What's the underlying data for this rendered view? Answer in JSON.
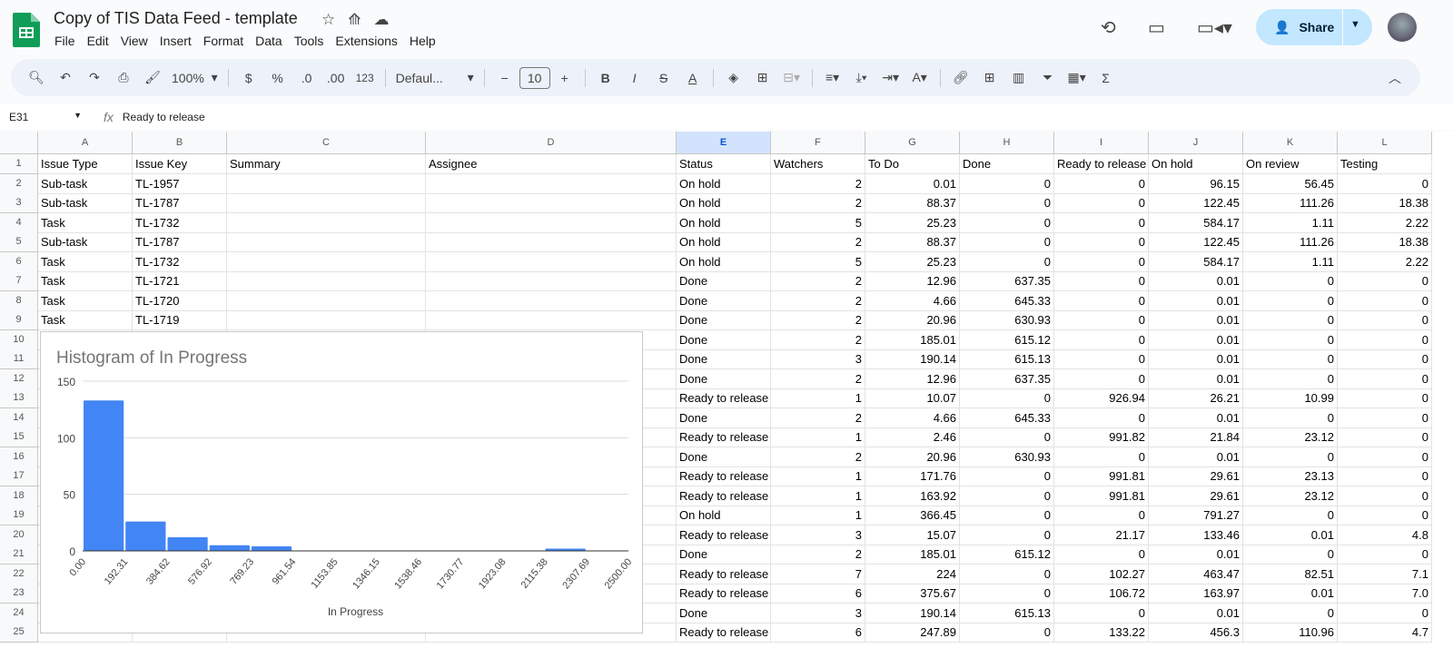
{
  "app": {
    "title": "Copy of TIS Data Feed - template",
    "menu": [
      "File",
      "Edit",
      "View",
      "Insert",
      "Format",
      "Data",
      "Tools",
      "Extensions",
      "Help"
    ],
    "share_label": "Share"
  },
  "toolbar": {
    "zoom": "100%",
    "currency": "$",
    "percent": "%",
    "dec_dec": ".0",
    "inc_dec": ".00",
    "format_123": "123",
    "font": "Defaul...",
    "font_size": "10"
  },
  "formula_bar": {
    "cell_ref": "E31",
    "fx": "fx",
    "value": "Ready to release"
  },
  "columns": [
    "A",
    "B",
    "C",
    "D",
    "E",
    "F",
    "G",
    "H",
    "I",
    "J",
    "K",
    "L"
  ],
  "headers": [
    "Issue Type",
    "Issue Key",
    "Summary",
    "Assignee",
    "Status",
    "Watchers",
    "To Do",
    "Done",
    "Ready to release",
    "On hold",
    "On review",
    "Testing"
  ],
  "rows": [
    [
      "Sub-task",
      "TL-1957",
      "",
      "",
      "On hold",
      "2",
      "0.01",
      "0",
      "0",
      "96.15",
      "56.45",
      "0"
    ],
    [
      "Sub-task",
      "TL-1787",
      "",
      "",
      "On hold",
      "2",
      "88.37",
      "0",
      "0",
      "122.45",
      "111.26",
      "18.38"
    ],
    [
      "Task",
      "TL-1732",
      "",
      "",
      "On hold",
      "5",
      "25.23",
      "0",
      "0",
      "584.17",
      "1.11",
      "2.22"
    ],
    [
      "Sub-task",
      "TL-1787",
      "",
      "",
      "On hold",
      "2",
      "88.37",
      "0",
      "0",
      "122.45",
      "111.26",
      "18.38"
    ],
    [
      "Task",
      "TL-1732",
      "",
      "",
      "On hold",
      "5",
      "25.23",
      "0",
      "0",
      "584.17",
      "1.11",
      "2.22"
    ],
    [
      "Task",
      "TL-1721",
      "",
      "",
      "Done",
      "2",
      "12.96",
      "637.35",
      "0",
      "0.01",
      "0",
      "0"
    ],
    [
      "Task",
      "TL-1720",
      "",
      "",
      "Done",
      "2",
      "4.66",
      "645.33",
      "0",
      "0.01",
      "0",
      "0"
    ],
    [
      "Task",
      "TL-1719",
      "",
      "",
      "Done",
      "2",
      "20.96",
      "630.93",
      "0",
      "0.01",
      "0",
      "0"
    ],
    [
      "",
      "",
      "",
      "",
      "Done",
      "2",
      "185.01",
      "615.12",
      "0",
      "0.01",
      "0",
      "0"
    ],
    [
      "",
      "",
      "",
      "",
      "Done",
      "3",
      "190.14",
      "615.13",
      "0",
      "0.01",
      "0",
      "0"
    ],
    [
      "",
      "",
      "",
      "",
      "Done",
      "2",
      "12.96",
      "637.35",
      "0",
      "0.01",
      "0",
      "0"
    ],
    [
      "",
      "",
      "",
      "",
      "Ready to release",
      "1",
      "10.07",
      "0",
      "926.94",
      "26.21",
      "10.99",
      "0"
    ],
    [
      "",
      "",
      "",
      "",
      "Done",
      "2",
      "4.66",
      "645.33",
      "0",
      "0.01",
      "0",
      "0"
    ],
    [
      "",
      "",
      "",
      "",
      "Ready to release",
      "1",
      "2.46",
      "0",
      "991.82",
      "21.84",
      "23.12",
      "0"
    ],
    [
      "",
      "",
      "",
      "",
      "Done",
      "2",
      "20.96",
      "630.93",
      "0",
      "0.01",
      "0",
      "0"
    ],
    [
      "",
      "",
      "",
      "",
      "Ready to release",
      "1",
      "171.76",
      "0",
      "991.81",
      "29.61",
      "23.13",
      "0"
    ],
    [
      "",
      "",
      "",
      "",
      "Ready to release",
      "1",
      "163.92",
      "0",
      "991.81",
      "29.61",
      "23.12",
      "0"
    ],
    [
      "",
      "",
      "",
      "",
      "On hold",
      "1",
      "366.45",
      "0",
      "0",
      "791.27",
      "0",
      "0"
    ],
    [
      "",
      "",
      "",
      "",
      "Ready to release",
      "3",
      "15.07",
      "0",
      "21.17",
      "133.46",
      "0.01",
      "4.8"
    ],
    [
      "",
      "",
      "",
      "",
      "Done",
      "2",
      "185.01",
      "615.12",
      "0",
      "0.01",
      "0",
      "0"
    ],
    [
      "",
      "",
      "",
      "",
      "Ready to release",
      "7",
      "224",
      "0",
      "102.27",
      "463.47",
      "82.51",
      "7.1"
    ],
    [
      "",
      "",
      "",
      "",
      "Ready to release",
      "6",
      "375.67",
      "0",
      "106.72",
      "163.97",
      "0.01",
      "7.0"
    ],
    [
      "",
      "",
      "",
      "",
      "Done",
      "3",
      "190.14",
      "615.13",
      "0",
      "0.01",
      "0",
      "0"
    ],
    [
      "",
      "",
      "",
      "",
      "Ready to release",
      "6",
      "247.89",
      "0",
      "133.22",
      "456.3",
      "110.96",
      "4.7"
    ]
  ],
  "chart_data": {
    "type": "bar",
    "title": "Histogram of In Progress",
    "xlabel": "In Progress",
    "ylabel": "",
    "x_ticks": [
      "0.00",
      "192.31",
      "384.62",
      "576.92",
      "769.23",
      "961.54",
      "1153.85",
      "1346.15",
      "1538.46",
      "1730.77",
      "1923.08",
      "2115.38",
      "2307.69",
      "2500.00"
    ],
    "y_ticks": [
      "0",
      "50",
      "100",
      "150"
    ],
    "ylim": [
      0,
      150
    ],
    "values": [
      133,
      26,
      12,
      5,
      4,
      0,
      0,
      0,
      0,
      0,
      0,
      2,
      0
    ],
    "color": "#4285f4",
    "grid": true
  }
}
